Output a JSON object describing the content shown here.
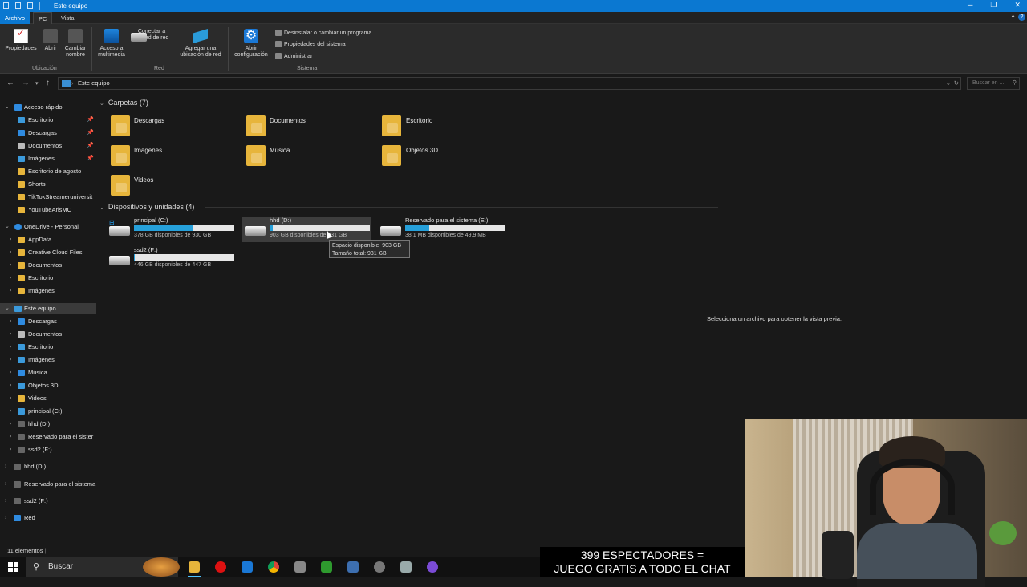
{
  "window": {
    "title": "Este equipo",
    "buttons": [
      "─",
      "❐",
      "✕"
    ]
  },
  "ribbon_tabs": [
    "Archivo",
    "PC",
    "Vista"
  ],
  "ribbon": {
    "buttons": [
      {
        "label": "Propiedades",
        "icon": "properties-icon"
      },
      {
        "label": "Abrir",
        "icon": "open-icon"
      },
      {
        "label": "Cambiar nombre",
        "icon": "rename-icon"
      },
      {
        "label": "Acceso a multimedia",
        "icon": "media-icon"
      },
      {
        "label": "Conectar a unidad de red",
        "icon": "network-drive-icon"
      },
      {
        "label": "Agregar una ubicación de red",
        "icon": "network-location-icon"
      },
      {
        "label": "Abrir configuración",
        "icon": "settings-icon"
      }
    ],
    "small_buttons": [
      "Desinstalar o cambiar un programa",
      "Propiedades del sistema",
      "Administrar"
    ],
    "groups": [
      "Ubicación",
      "Red",
      "Sistema"
    ]
  },
  "address": {
    "path": "Este equipo",
    "separator": "›",
    "search_placeholder": "Buscar en ..."
  },
  "nav": {
    "quick_access": {
      "label": "Acceso rápido",
      "items": [
        "Escritorio",
        "Descargas",
        "Documentos",
        "Imágenes",
        "Escritorio de agosto",
        "Shorts",
        "TikTokStreameruniversit",
        "YouTubeArisMC"
      ]
    },
    "onedrive": {
      "label": "OneDrive - Personal",
      "items": [
        "AppData",
        "Creative Cloud Files",
        "Documentos",
        "Escritorio",
        "Imágenes"
      ]
    },
    "this_pc": {
      "label": "Este equipo",
      "items": [
        "Descargas",
        "Documentos",
        "Escritorio",
        "Imágenes",
        "Música",
        "Objetos 3D",
        "Videos",
        "principal (C:)",
        "hhd (D:)",
        "Reservado para el sister",
        "ssd2 (F:)"
      ]
    },
    "extra": [
      "hhd (D:)",
      "Reservado para el sistema",
      "ssd2 (F:)",
      "Red"
    ]
  },
  "main": {
    "folders_header": "Carpetas (7)",
    "folders": [
      "Descargas",
      "Documentos",
      "Escritorio",
      "Imágenes",
      "Música",
      "Objetos 3D",
      "Videos"
    ],
    "drives_header": "Dispositivos y unidades (4)",
    "drives": [
      {
        "name": "principal (C:)",
        "space": "378 GB disponibles de 930 GB",
        "used_fraction": 0.59
      },
      {
        "name": "hhd (D:)",
        "space": "903 GB disponibles de 931 GB",
        "used_fraction": 0.03
      },
      {
        "name": "Reservado para el sistema (E:)",
        "space": "38.1 MB disponibles de 49.9 MB",
        "used_fraction": 0.24
      },
      {
        "name": "ssd2 (F:)",
        "space": "446 GB disponibles de 447 GB",
        "used_fraction": 0.01
      }
    ],
    "tooltip": {
      "line1": "Espacio disponible: 903 GB",
      "line2": "Tamaño total: 931 GB"
    },
    "preview_text": "Selecciona un archivo para obtener la vista previa."
  },
  "status": {
    "items": "11 elementos"
  },
  "taskbar": {
    "search": "Buscar"
  },
  "stream_overlay": {
    "line1": "399 ESPECTADORES =",
    "line2": "JUEGO GRATIS A TODO EL CHAT"
  },
  "colors": {
    "accent": "#0b78d1",
    "drive_bar": "#26a0da",
    "background": "#191919"
  }
}
